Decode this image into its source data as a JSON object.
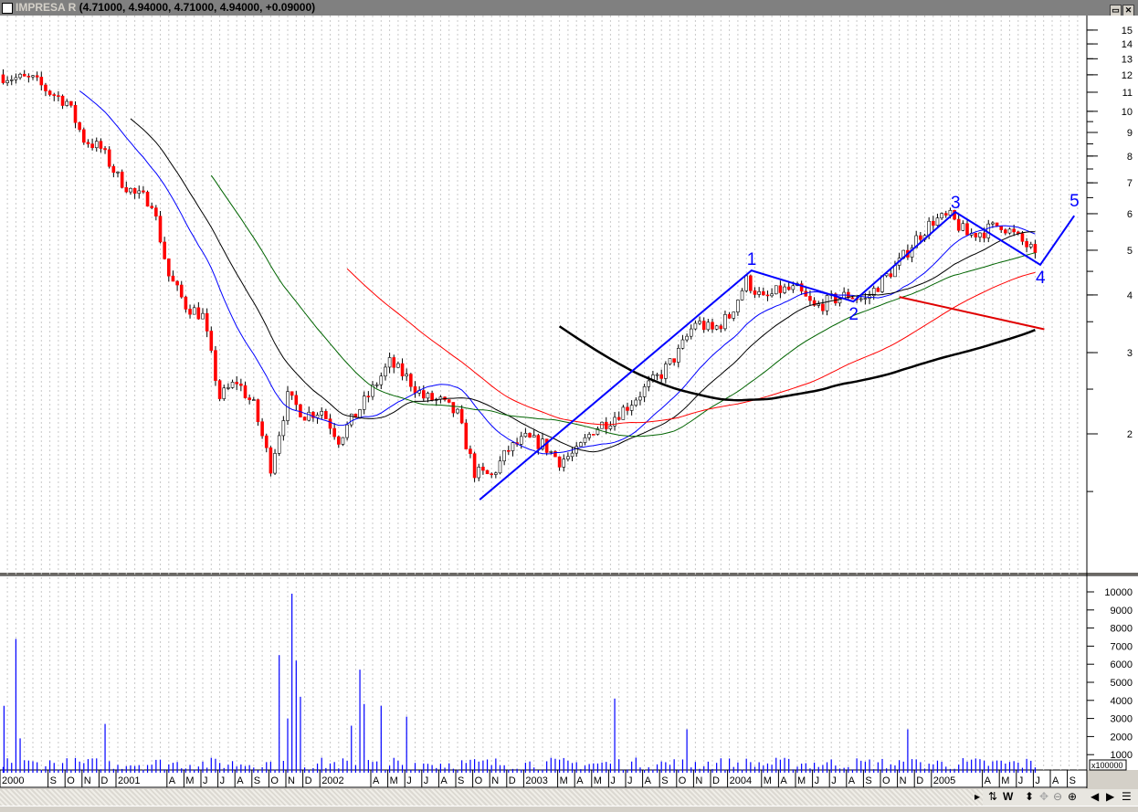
{
  "window": {
    "symbol": "IMPRESA R",
    "quote": "(4.71000, 4.94000, 4.71000, 4.94000, +0.09000)",
    "buttons": [
      "restore",
      "close"
    ]
  },
  "chart_data": [
    {
      "type": "candlestick",
      "scale": "log",
      "ylim": [
        1.3,
        16
      ],
      "yticks": [
        2,
        3,
        4,
        5,
        6,
        7,
        8,
        9,
        10,
        11,
        12,
        13,
        14,
        15
      ],
      "xlim": [
        "2000-06",
        "2005-09"
      ],
      "grid": "vertical dotted",
      "colors": {
        "down": "#ff0000",
        "up": "#ffffff",
        "ma": [
          "#0000ff",
          "#000000",
          "#006400",
          "#ff0000",
          "#000000"
        ],
        "wave": "#0000ff",
        "trend": "#e00000"
      },
      "monthly_close": [
        [
          "2000-06",
          12
        ],
        [
          "2000-07",
          11.8
        ],
        [
          "2000-08",
          11.7
        ],
        [
          "2000-09",
          11
        ],
        [
          "2000-10",
          10.5
        ],
        [
          "2000-11",
          8.7
        ],
        [
          "2000-12",
          8.3
        ],
        [
          "2001-01",
          7.2
        ],
        [
          "2001-02",
          6.6
        ],
        [
          "2001-03",
          6.4
        ],
        [
          "2001-04",
          4.4
        ],
        [
          "2001-05",
          3.8
        ],
        [
          "2001-06",
          3.6
        ],
        [
          "2001-07",
          2.4
        ],
        [
          "2001-08",
          2.6
        ],
        [
          "2001-09",
          2.3
        ],
        [
          "2001-10",
          1.7
        ],
        [
          "2001-11",
          2.4
        ],
        [
          "2001-12",
          2.2
        ],
        [
          "2002-01",
          2.25
        ],
        [
          "2002-02",
          1.95
        ],
        [
          "2002-03",
          2.2
        ],
        [
          "2002-04",
          2.5
        ],
        [
          "2002-05",
          2.85
        ],
        [
          "2002-06",
          2.65
        ],
        [
          "2002-07",
          2.4
        ],
        [
          "2002-08",
          2.35
        ],
        [
          "2002-09",
          2.2
        ],
        [
          "2002-10",
          1.65
        ],
        [
          "2002-11",
          1.62
        ],
        [
          "2002-12",
          1.85
        ],
        [
          "2003-01",
          1.95
        ],
        [
          "2003-02",
          1.9
        ],
        [
          "2003-03",
          1.75
        ],
        [
          "2003-04",
          1.82
        ],
        [
          "2003-05",
          2.05
        ],
        [
          "2003-06",
          2.15
        ],
        [
          "2003-07",
          2.3
        ],
        [
          "2003-08",
          2.5
        ],
        [
          "2003-09",
          2.7
        ],
        [
          "2003-10",
          3.0
        ],
        [
          "2003-11",
          3.5
        ],
        [
          "2003-12",
          3.35
        ],
        [
          "2004-01",
          3.6
        ],
        [
          "2004-02",
          4.3
        ],
        [
          "2004-03",
          3.9
        ],
        [
          "2004-04",
          4.1
        ],
        [
          "2004-05",
          4.1
        ],
        [
          "2004-06",
          3.75
        ],
        [
          "2004-07",
          3.9
        ],
        [
          "2004-08",
          4.0
        ],
        [
          "2004-09",
          3.9
        ],
        [
          "2004-10",
          4.3
        ],
        [
          "2004-11",
          4.7
        ],
        [
          "2004-12",
          5.3
        ],
        [
          "2005-01",
          5.8
        ],
        [
          "2005-02",
          5.9
        ],
        [
          "2005-03",
          5.4
        ],
        [
          "2005-04",
          5.5
        ],
        [
          "2005-05",
          5.7
        ],
        [
          "2005-06",
          5.3
        ],
        [
          "2005-07",
          4.94
        ]
      ],
      "moving_average_weeks": [
        19,
        31,
        50,
        82,
        132
      ],
      "elliott_wave": [
        {
          "label": "",
          "date": "2002-10",
          "price": 1.44
        },
        {
          "label": "1",
          "date": "2004-02",
          "price": 4.52
        },
        {
          "label": "2",
          "date": "2004-08",
          "price": 3.87
        },
        {
          "label": "3",
          "date": "2005-02",
          "price": 6.05
        },
        {
          "label": "4",
          "date": "2005-07",
          "price": 4.65
        },
        {
          "label": "5",
          "date": "2005-09",
          "price": 5.94
        }
      ],
      "trendline": [
        {
          "date": "2004-11",
          "price": 3.96
        },
        {
          "date": "2005-07",
          "price": 3.37
        }
      ]
    },
    {
      "type": "bar",
      "name": "volume",
      "unit": "x100000",
      "ylim": [
        0,
        10500
      ],
      "yticks": [
        1000,
        2000,
        3000,
        4000,
        5000,
        6000,
        7000,
        8000,
        9000,
        10000
      ],
      "color": "#0000ff",
      "typical": 500,
      "spikes": [
        [
          "2000-06",
          7400
        ],
        [
          "2000-06",
          3700
        ],
        [
          "2000-07",
          1900
        ],
        [
          "2000-12",
          2700
        ],
        [
          "2001-10",
          6500
        ],
        [
          "2001-10",
          3000
        ],
        [
          "2001-11",
          9900
        ],
        [
          "2001-11",
          6200
        ],
        [
          "2001-11",
          4200
        ],
        [
          "2002-02",
          2600
        ],
        [
          "2002-03",
          5700
        ],
        [
          "2002-03",
          3800
        ],
        [
          "2002-04",
          3700
        ],
        [
          "2002-05",
          3100
        ],
        [
          "2003-06",
          4100
        ],
        [
          "2003-10",
          2400
        ],
        [
          "2004-11",
          2400
        ]
      ]
    }
  ],
  "x_axis_labels": [
    [
      "2000-06",
      "2000"
    ],
    [
      "2000-09",
      "S"
    ],
    [
      "2000-10",
      "O"
    ],
    [
      "2000-11",
      "N"
    ],
    [
      "2000-12",
      "D"
    ],
    [
      "2001-01",
      "2001"
    ],
    [
      "2001-04",
      "A"
    ],
    [
      "2001-05",
      "M"
    ],
    [
      "2001-06",
      "J"
    ],
    [
      "2001-07",
      "J"
    ],
    [
      "2001-08",
      "A"
    ],
    [
      "2001-09",
      "S"
    ],
    [
      "2001-10",
      "O"
    ],
    [
      "2001-11",
      "N"
    ],
    [
      "2001-12",
      "D"
    ],
    [
      "2002-01",
      "2002"
    ],
    [
      "2002-04",
      "A"
    ],
    [
      "2002-05",
      "M"
    ],
    [
      "2002-06",
      "J"
    ],
    [
      "2002-07",
      "J"
    ],
    [
      "2002-08",
      "A"
    ],
    [
      "2002-09",
      "S"
    ],
    [
      "2002-10",
      "O"
    ],
    [
      "2002-11",
      "N"
    ],
    [
      "2002-12",
      "D"
    ],
    [
      "2003-01",
      "2003"
    ],
    [
      "2003-03",
      "M"
    ],
    [
      "2003-04",
      "A"
    ],
    [
      "2003-05",
      "M"
    ],
    [
      "2003-06",
      "J"
    ],
    [
      "2003-07",
      "J"
    ],
    [
      "2003-08",
      "A"
    ],
    [
      "2003-09",
      "S"
    ],
    [
      "2003-10",
      "O"
    ],
    [
      "2003-11",
      "N"
    ],
    [
      "2003-12",
      "D"
    ],
    [
      "2004-01",
      "2004"
    ],
    [
      "2004-03",
      "M"
    ],
    [
      "2004-04",
      "A"
    ],
    [
      "2004-05",
      "M"
    ],
    [
      "2004-06",
      "J"
    ],
    [
      "2004-07",
      "J"
    ],
    [
      "2004-08",
      "A"
    ],
    [
      "2004-09",
      "S"
    ],
    [
      "2004-10",
      "O"
    ],
    [
      "2004-11",
      "N"
    ],
    [
      "2004-12",
      "D"
    ],
    [
      "2005-01",
      "2005"
    ],
    [
      "2005-04",
      "A"
    ],
    [
      "2005-05",
      "M"
    ],
    [
      "2005-06",
      "J"
    ],
    [
      "2005-07",
      "J"
    ],
    [
      "2005-08",
      "A"
    ],
    [
      "2005-09",
      "S"
    ]
  ],
  "toolbar": {
    "icons": [
      "refresh-icon",
      "weekly-icon",
      "vertical-resize-icon",
      "crosshair-icon",
      "zoom-out-icon",
      "zoom-in-icon",
      "scroll-left-icon",
      "scroll-right-icon",
      "properties-icon"
    ],
    "weekly_label": "W"
  }
}
